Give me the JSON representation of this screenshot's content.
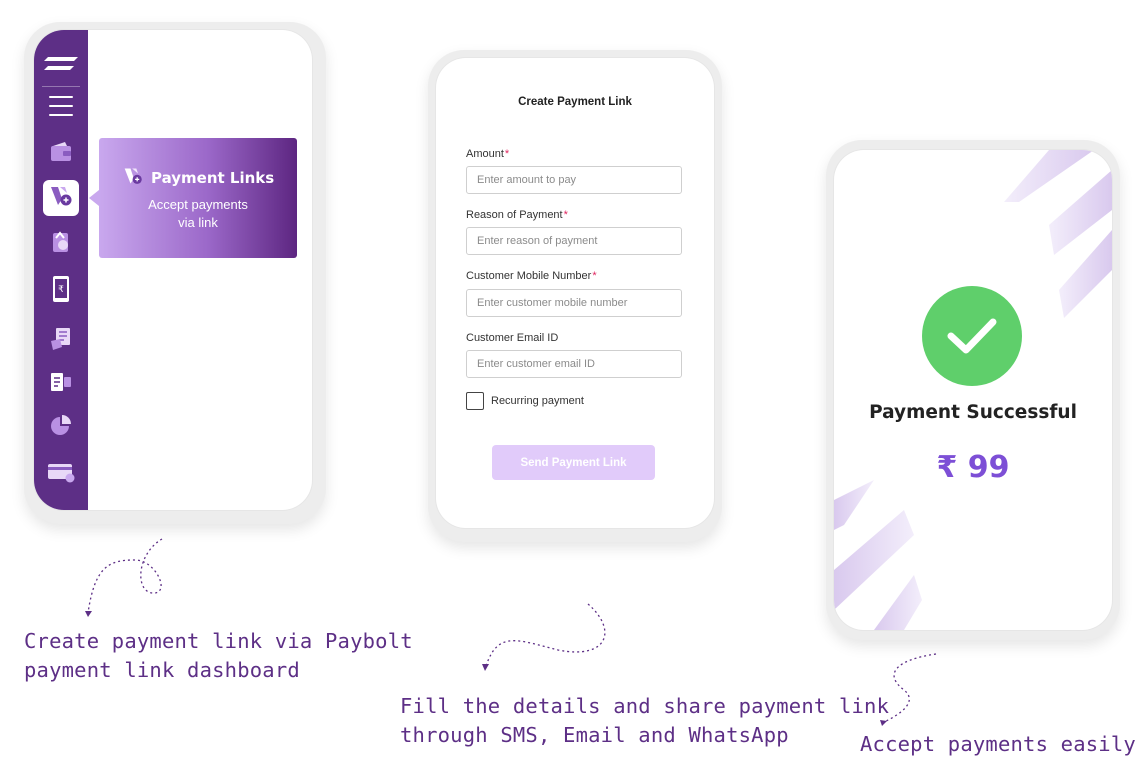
{
  "dashboard": {
    "sidebar_icons": [
      "brand-logo-icon",
      "menu-icon",
      "wallet-icon",
      "payment-links-icon",
      "payout-icon",
      "mobile-rupee-icon",
      "documents-icon",
      "ledger-icon",
      "analytics-icon",
      "card-icon"
    ],
    "popover": {
      "title": "Payment Links",
      "description_line1": "Accept payments",
      "description_line2": "via link"
    }
  },
  "form": {
    "title": "Create Payment Link",
    "fields": [
      {
        "label": "Amount",
        "required": "*",
        "placeholder": "Enter amount to pay"
      },
      {
        "label": "Reason of Payment",
        "required": "*",
        "placeholder": "Enter reason of payment"
      },
      {
        "label": "Customer Mobile Number",
        "required": "*",
        "placeholder": "Enter customer mobile number"
      },
      {
        "label": "Customer Email ID",
        "required": "",
        "placeholder": "Enter customer email ID"
      }
    ],
    "recurring_label": "Recurring payment",
    "send_button": "Send Payment Link"
  },
  "success": {
    "title": "Payment Successful",
    "amount": "₹ 99"
  },
  "captions": {
    "step1_line1": "Create payment link via Paybolt",
    "step1_line2": "payment link dashboard",
    "step2_line1": "Fill the details and share payment link",
    "step2_line2": "through SMS, Email and WhatsApp",
    "step3": "Accept payments easily"
  },
  "colors": {
    "brand_purple": "#5d2f86",
    "success_green": "#5fcf6b",
    "amount_purple": "#7d4fd6",
    "button_disabled": "#e1cbfa"
  }
}
